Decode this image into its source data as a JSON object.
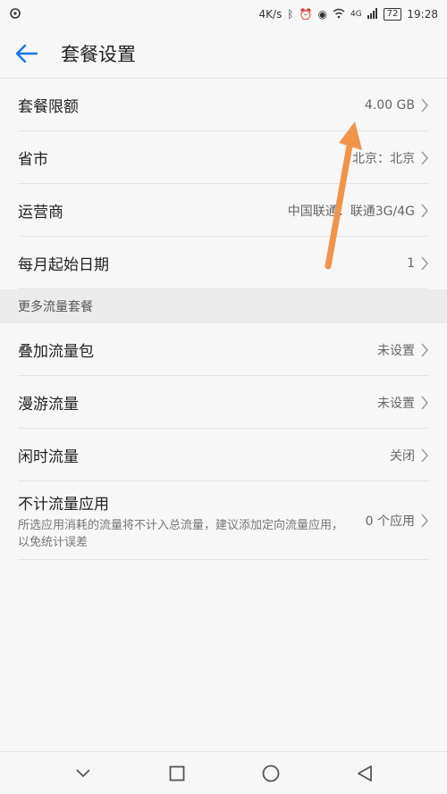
{
  "status_bar": {
    "app_icon": "weibo-icon",
    "speed": "4K/s",
    "network": "4G",
    "battery": "72",
    "time": "19:28"
  },
  "app_bar": {
    "title": "套餐设置"
  },
  "rows": [
    {
      "label": "套餐限额",
      "value": "4.00 GB"
    },
    {
      "label": "省市",
      "value": "北京：北京"
    },
    {
      "label": "运营商",
      "value": "中国联通：联通3G/4G"
    },
    {
      "label": "每月起始日期",
      "value": "1"
    }
  ],
  "section": {
    "title": "更多流量套餐"
  },
  "rows2": [
    {
      "label": "叠加流量包",
      "value": "未设置"
    },
    {
      "label": "漫游流量",
      "value": "未设置"
    },
    {
      "label": "闲时流量",
      "value": "关闭"
    }
  ],
  "exempt": {
    "title": "不计流量应用",
    "desc": "所选应用消耗的流量将不计入总流量，建议添加定向流量应用，以免统计误差",
    "value": "0 个应用"
  },
  "colors": {
    "accent": "#1a73e8",
    "annotation_arrow": "#f0944a"
  }
}
